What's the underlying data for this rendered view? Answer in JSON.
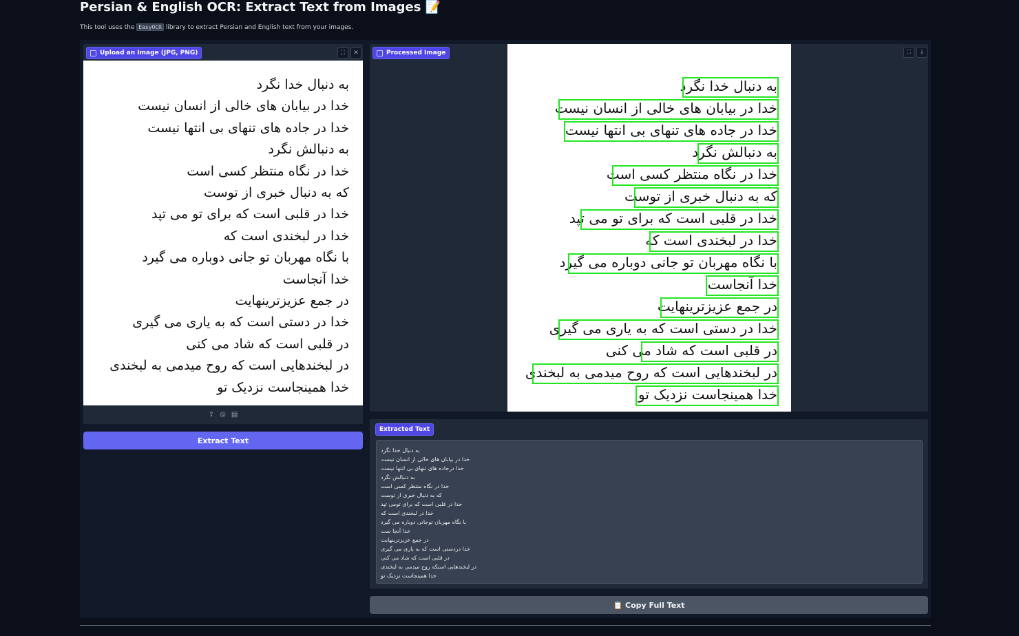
{
  "header": {
    "title": "Persian & English OCR: Extract Text from Images 📝",
    "description_before": "This tool uses the ",
    "library_name": "EasyOCR",
    "description_after": " library to extract Persian and English text from your images."
  },
  "upload": {
    "label": "Upload an Image (JPG, PNG)",
    "lines": [
      "به دنبال خدا نگرد",
      "خدا در بیابان های خالی از انسان نیست",
      "خدا در جاده های تنهای بی انتها نیست",
      "به دنبالش نگرد",
      "خدا در نگاه منتظر کسی است",
      "که به دنبال خبری از توست",
      "خدا در قلبی است که برای تو می تپد",
      "خدا در لبخندی است که",
      "با نگاه مهربان تو جانی دوباره می گیرد",
      "خدا آنجاست",
      "در جمع عزیزترینهایت",
      "خدا در دستی است که به یاری می گیری",
      "در قلبی است که شاد می کنی",
      "در لبخندهایی است که روح میدمی  به لبخندی",
      "خدا همینجاست نزدیک تو"
    ]
  },
  "extract_button": {
    "label": "Extract Text"
  },
  "processed": {
    "label": "Processed Image"
  },
  "extracted": {
    "label": "Extracted Text",
    "lines": [
      "به دنبال خدا نگرد",
      "خدا در بیابان های خالی از انسان نیست",
      "خدا درجاده های تنهای بی انتها نیست",
      "به دنبالش نگرد",
      "خدا در نگاه منتظر کسی است",
      "که به دنبال خبری از توست",
      "خدا در  قلبی است که برای تومی تپد",
      "خدا در لبخندی است که",
      "با نگاه مهربان توجانی دوباره می گیرد",
      "خدا آنجا ست",
      "در جمع عزیزترینهایت",
      "خدا دردستی است که به یاری می گیری",
      "در قلبی است که شاد می کنی",
      "در لبخندهایی استکه روح میدمی به لبخندی",
      "خدا   همینجاست نزدیک تو"
    ]
  },
  "copy_button": {
    "label": "📋 Copy Full Text"
  },
  "colors": {
    "accent": "#6366f1",
    "box": "#22e622",
    "background": "#0b0f19"
  },
  "icons": [
    "fullscreen-icon",
    "close-icon",
    "download-icon",
    "upload-icon",
    "webcam-icon",
    "clipboard-icon",
    "image-icon"
  ]
}
